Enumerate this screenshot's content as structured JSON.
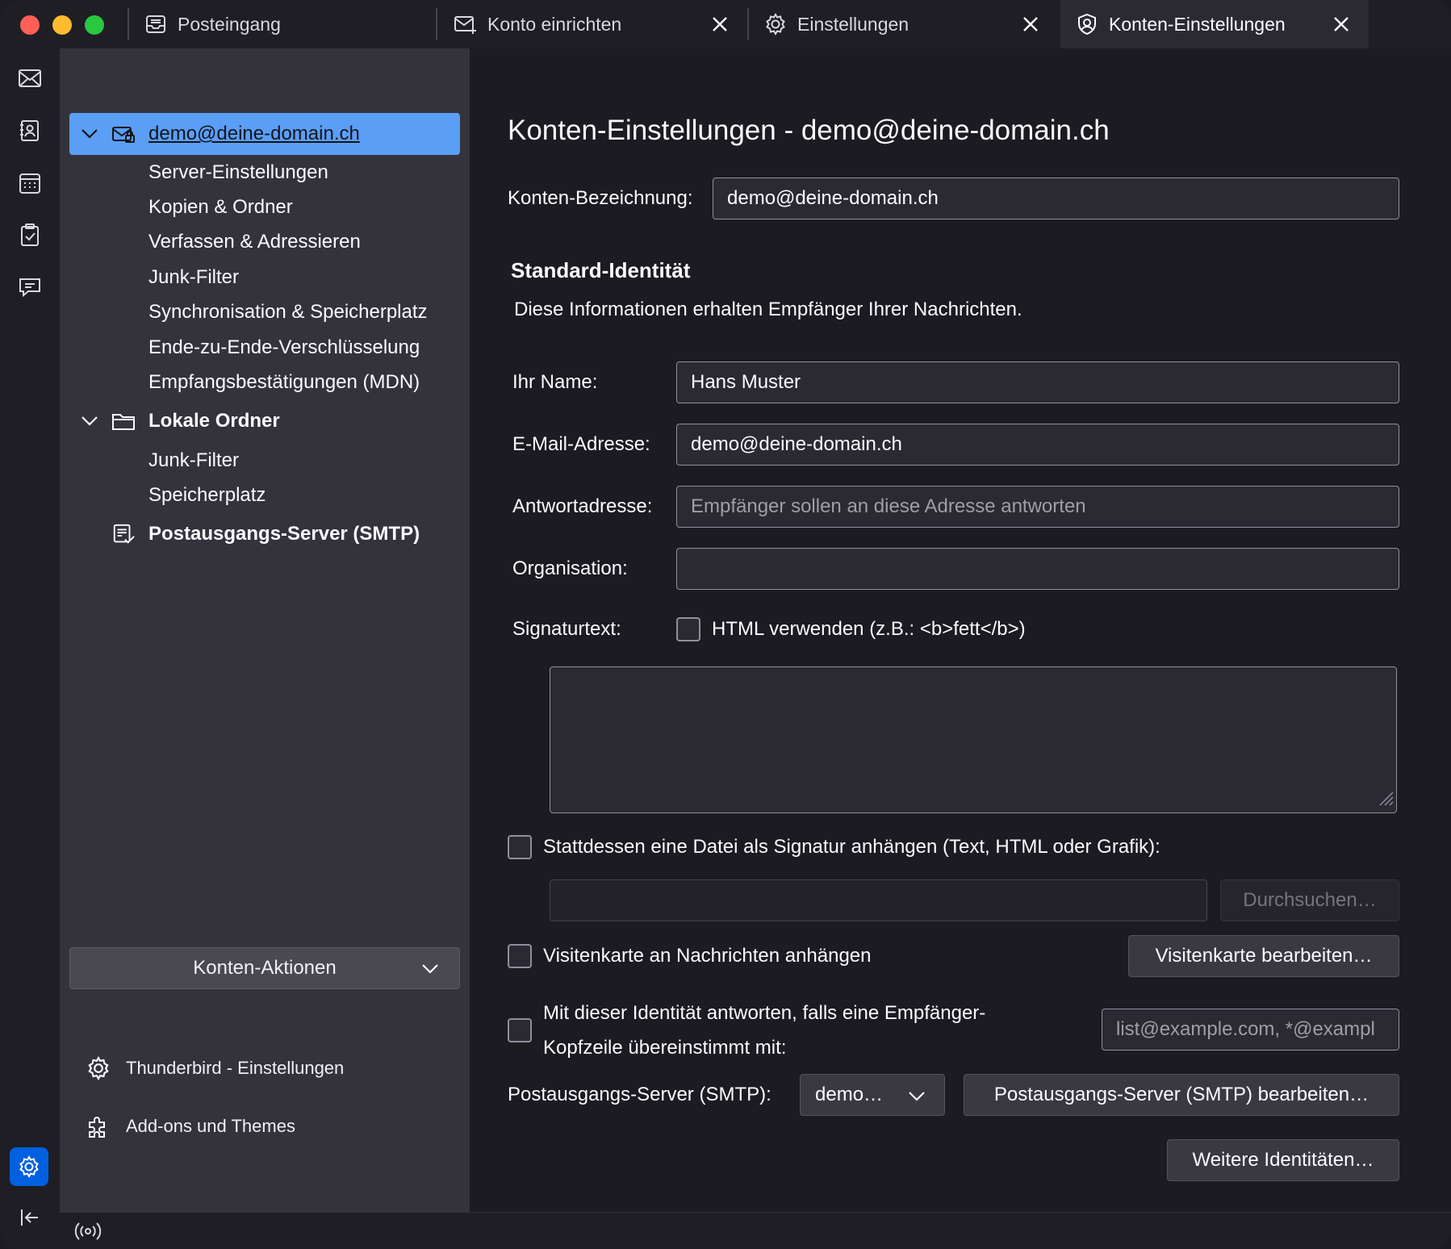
{
  "tabs": {
    "inbox": "Posteingang",
    "setup": "Konto einrichten",
    "settings": "Einstellungen",
    "account_settings": "Konten-Einstellungen"
  },
  "sidebar": {
    "account": {
      "email": "demo@deine-domain.ch",
      "children": [
        "Server-Einstellungen",
        "Kopien & Ordner",
        "Verfassen & Adressieren",
        "Junk-Filter",
        "Synchronisation & Speicherplatz",
        "Ende-zu-Ende-Verschlüsselung",
        "Empfangsbestätigungen (MDN)"
      ]
    },
    "local": {
      "label": "Lokale Ordner",
      "children": [
        "Junk-Filter",
        "Speicherplatz"
      ]
    },
    "smtp": "Postausgangs-Server (SMTP)",
    "account_actions": "Konten-Aktionen",
    "footer": {
      "settings": "Thunderbird - Einstellungen",
      "addons": "Add-ons und Themes"
    }
  },
  "main": {
    "title": "Konten-Einstellungen - demo@deine-domain.ch",
    "account_name_label": "Konten-Bezeichnung:",
    "account_name_value": "demo@deine-domain.ch",
    "identity_title": "Standard-Identität",
    "identity_desc": "Diese Informationen erhalten Empfänger Ihrer Nachrichten.",
    "name_label": "Ihr Name:",
    "name_value": "Hans Muster",
    "email_label": "E-Mail-Adresse:",
    "email_value": "demo@deine-domain.ch",
    "reply_label": "Antwortadresse:",
    "reply_placeholder": "Empfänger sollen an diese Adresse antworten",
    "org_label": "Organisation:",
    "org_value": "",
    "sig_label": "Signaturtext:",
    "sig_html_label": "HTML verwenden (z.B.: <b>fett</b>)",
    "sig_file_label": "Stattdessen eine Datei als Signatur anhängen (Text, HTML oder Grafik):",
    "browse_label": "Durchsuchen…",
    "vcard_label": "Visitenkarte an Nachrichten anhängen",
    "vcard_edit_label": "Visitenkarte bearbeiten…",
    "reply_match_label_1": "Mit dieser Identität antworten, falls eine Empfänger-",
    "reply_match_label_2": "Kopfzeile übereinstimmt mit:",
    "reply_match_placeholder": "list@example.com, *@exampl",
    "smtp_label": "Postausgangs-Server (SMTP):",
    "smtp_value": "demo…",
    "smtp_edit_label": "Postausgangs-Server (SMTP) bearbeiten…",
    "more_identities_label": "Weitere Identitäten…"
  }
}
